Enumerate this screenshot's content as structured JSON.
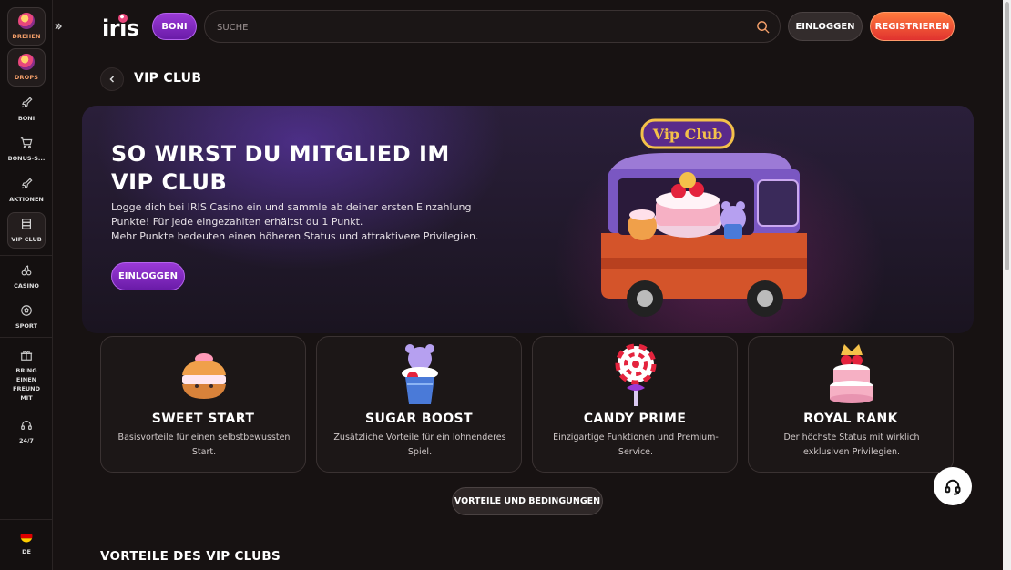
{
  "sidebar": {
    "spin_label": "DREHEN",
    "drops_label": "DROPS",
    "items": [
      {
        "label": "BONI",
        "icon": "rocket-icon"
      },
      {
        "label": "BONUS-S...",
        "icon": "cart-icon"
      },
      {
        "label": "AKTIONEN",
        "icon": "rocket-icon"
      },
      {
        "label": "VIP CLUB",
        "icon": "book-icon"
      },
      {
        "label": "CASINO",
        "icon": "cherries-icon"
      },
      {
        "label": "SPORT",
        "icon": "soccer-ball-icon"
      },
      {
        "label": "BRING EINEN FREUND MIT",
        "icon": "gift-icon"
      },
      {
        "label": "24/7",
        "icon": "headset-icon"
      }
    ],
    "language": "DE"
  },
  "header": {
    "logo": "iris",
    "boni_label": "BONI",
    "search_placeholder": "SUCHE",
    "login_label": "EINLOGGEN",
    "register_label": "REGISTRIEREN"
  },
  "page": {
    "title": "VIP CLUB"
  },
  "hero": {
    "title": "SO WIRST DU MITGLIED IM VIP CLUB",
    "text": "Logge dich bei IRIS Casino ein und sammle ab deiner ersten Einzahlung Punkte! Für jede eingezahlten erhältst du 1 Punkt.\nMehr Punkte bedeuten einen höheren Status und attraktivere Privilegien.",
    "button_label": "EINLOGGEN",
    "sign_text": "Vip Club"
  },
  "tiers": [
    {
      "name": "SWEET START",
      "description": "Basisvorteile für einen selbstbewussten Start."
    },
    {
      "name": "SUGAR BOOST",
      "description": "Zusätzliche Vorteile für ein lohnenderes Spiel."
    },
    {
      "name": "CANDY PRIME",
      "description": "Einzigartige Funktionen und Premium-Service."
    },
    {
      "name": "ROYAL RANK",
      "description": "Der höchste Status mit wirklich exklusiven Privilegien."
    }
  ],
  "benefits_button_label": "VORTEILE UND BEDINGUNGEN",
  "section_title": "VORTEILE DES VIP CLUBS",
  "colors": {
    "background": "#171212",
    "accent_purple": "#8a2be2",
    "accent_orange": "#ff6a3d"
  }
}
